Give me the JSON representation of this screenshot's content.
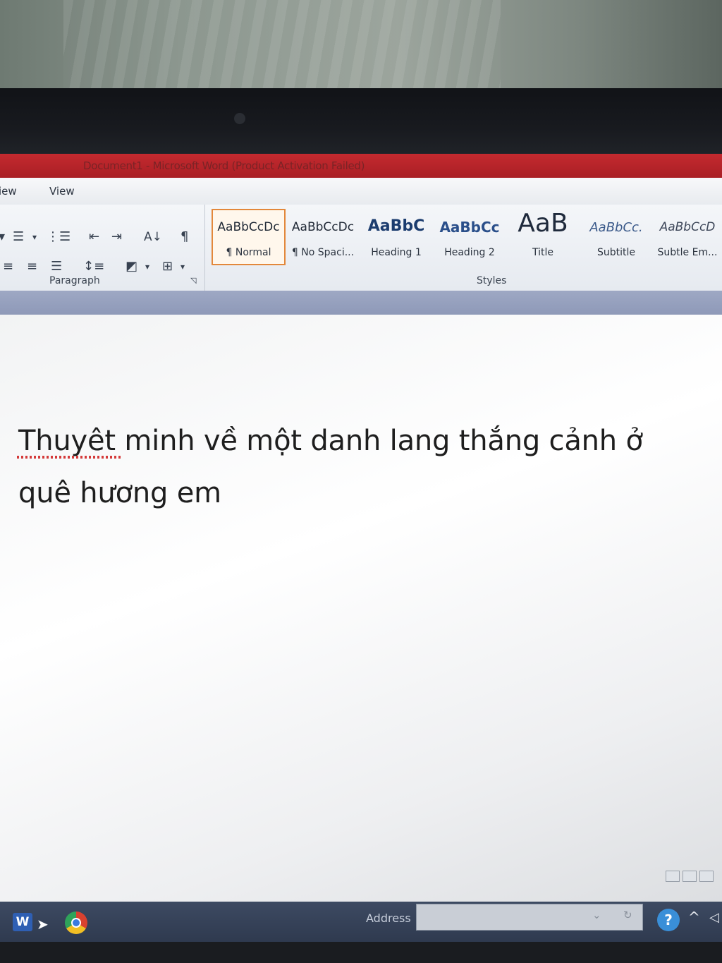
{
  "window": {
    "title": "Document1 - Microsoft Word (Product Activation Failed)"
  },
  "tabs": [
    {
      "label": "iew"
    },
    {
      "label": "View"
    }
  ],
  "ribbon": {
    "paragraph_group_label": "Paragraph",
    "styles_group_label": "Styles",
    "styles": [
      {
        "sample": "AaBbCcDc",
        "name": "¶ Normal",
        "selected": true
      },
      {
        "sample": "AaBbCcDc",
        "name": "¶ No Spaci...",
        "selected": false
      },
      {
        "sample": "AaBbC",
        "name": "Heading 1",
        "selected": false
      },
      {
        "sample": "AaBbCc",
        "name": "Heading 2",
        "selected": false
      },
      {
        "sample": "AaB",
        "name": "Title",
        "selected": false
      },
      {
        "sample": "AaBbCc.",
        "name": "Subtitle",
        "selected": false
      },
      {
        "sample": "AaBbCcD",
        "name": "Subtle Em...",
        "selected": false
      }
    ]
  },
  "document": {
    "line1": "Thuyêt minh về một danh lang thắng cảnh ở",
    "line2": "quê hương em"
  },
  "taskbar": {
    "word_icon_text": "W",
    "address_label": "Address",
    "help_icon_text": "?"
  },
  "colors": {
    "title_bar": "#c42a2f",
    "selected_style_border": "#e3883b",
    "taskbar": "#3d4a62"
  }
}
